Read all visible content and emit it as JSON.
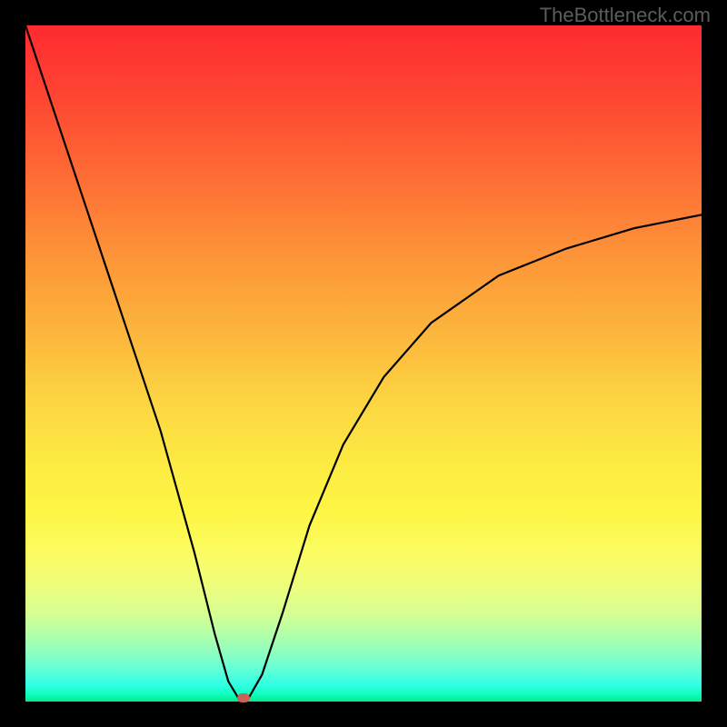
{
  "watermark": "TheBottleneck.com",
  "chart_data": {
    "type": "line",
    "title": "",
    "xlabel": "",
    "ylabel": "",
    "xlim": [
      0,
      100
    ],
    "ylim": [
      0,
      100
    ],
    "gradient_stops": [
      {
        "pos": 0,
        "color": "#fe2a30"
      },
      {
        "pos": 50,
        "color": "#fcd641"
      },
      {
        "pos": 100,
        "color": "#06e787"
      }
    ],
    "series": [
      {
        "name": "bottleneck-curve",
        "x": [
          0,
          5,
          10,
          15,
          20,
          25,
          28,
          30,
          31.5,
          33,
          35,
          38,
          42,
          47,
          53,
          60,
          70,
          80,
          90,
          100
        ],
        "y": [
          100,
          85,
          70,
          55,
          40,
          22,
          10,
          3,
          0.5,
          0.5,
          4,
          13,
          26,
          38,
          48,
          56,
          63,
          67,
          70,
          72
        ]
      }
    ],
    "marker": {
      "x": 32.3,
      "y": 0.5,
      "color": "#c96258"
    },
    "annotations": []
  }
}
